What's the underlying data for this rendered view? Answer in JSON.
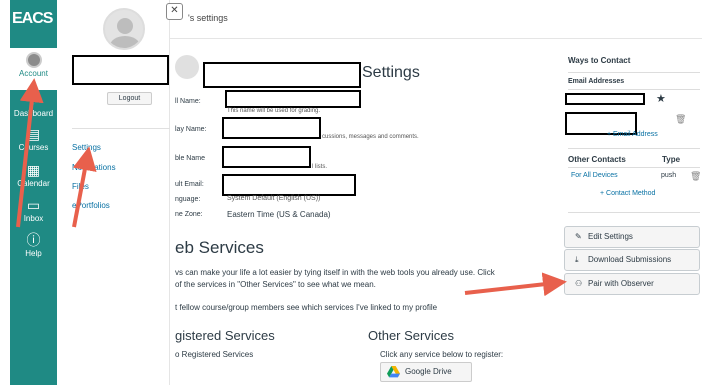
{
  "nav": {
    "logo": "EACS",
    "items": [
      {
        "label": "Account",
        "icon": "account-icon"
      },
      {
        "label": "Dashboard",
        "icon": "dashboard-icon"
      },
      {
        "label": "Courses",
        "icon": "courses-icon"
      },
      {
        "label": "Calendar",
        "icon": "calendar-icon"
      },
      {
        "label": "Inbox",
        "icon": "inbox-icon"
      },
      {
        "label": "Help",
        "icon": "help-icon"
      }
    ]
  },
  "tray": {
    "logout": "Logout",
    "links": [
      "Settings",
      "Notifications",
      "Files",
      "ePortfolios"
    ]
  },
  "main": {
    "header": "'s settings",
    "title": "Settings",
    "fields": [
      {
        "label": "ll Name:",
        "value": "",
        "note": "This name will be used for grading."
      },
      {
        "label": "lay Name:",
        "value": "",
        "note": "cussions, messages and comments."
      },
      {
        "label": "ble Name",
        "value": "",
        "note": "l lists."
      },
      {
        "label": "ult Email:",
        "value": "",
        "note": ""
      },
      {
        "label": "nguage:",
        "value": "System Default (English (US))",
        "note": ""
      },
      {
        "label": "ne Zone:",
        "value": "Eastern Time (US & Canada)",
        "note": ""
      }
    ],
    "web_services": {
      "title": "eb Services",
      "line1": "vs can make your life a lot easier by tying itself in with the web tools you already use. Click",
      "line2": "of the services in \"Other Services\" to see what we mean.",
      "checkbox": "t fellow course/group members see which services I've linked to my profile",
      "registered_title": "gistered Services",
      "registered_text": "o Registered Services",
      "other_title": "Other Services",
      "other_text": "Click any service below to register:",
      "gdrive": "Google Drive"
    }
  },
  "sidebar": {
    "ways_to_contact": "Ways to Contact",
    "email_addresses": "Email Addresses",
    "add_email": "+ Email Address",
    "other_contacts": "Other Contacts",
    "type": "Type",
    "all_devices": "For All Devices",
    "push": "push",
    "contact_method": "+ Contact Method",
    "buttons": {
      "edit": "Edit Settings",
      "download": "Download Submissions",
      "observer": "Pair with Observer"
    }
  },
  "colors": {
    "nav": "#1f8a84",
    "link": "#0770a3",
    "arrow": "#e8604c"
  }
}
